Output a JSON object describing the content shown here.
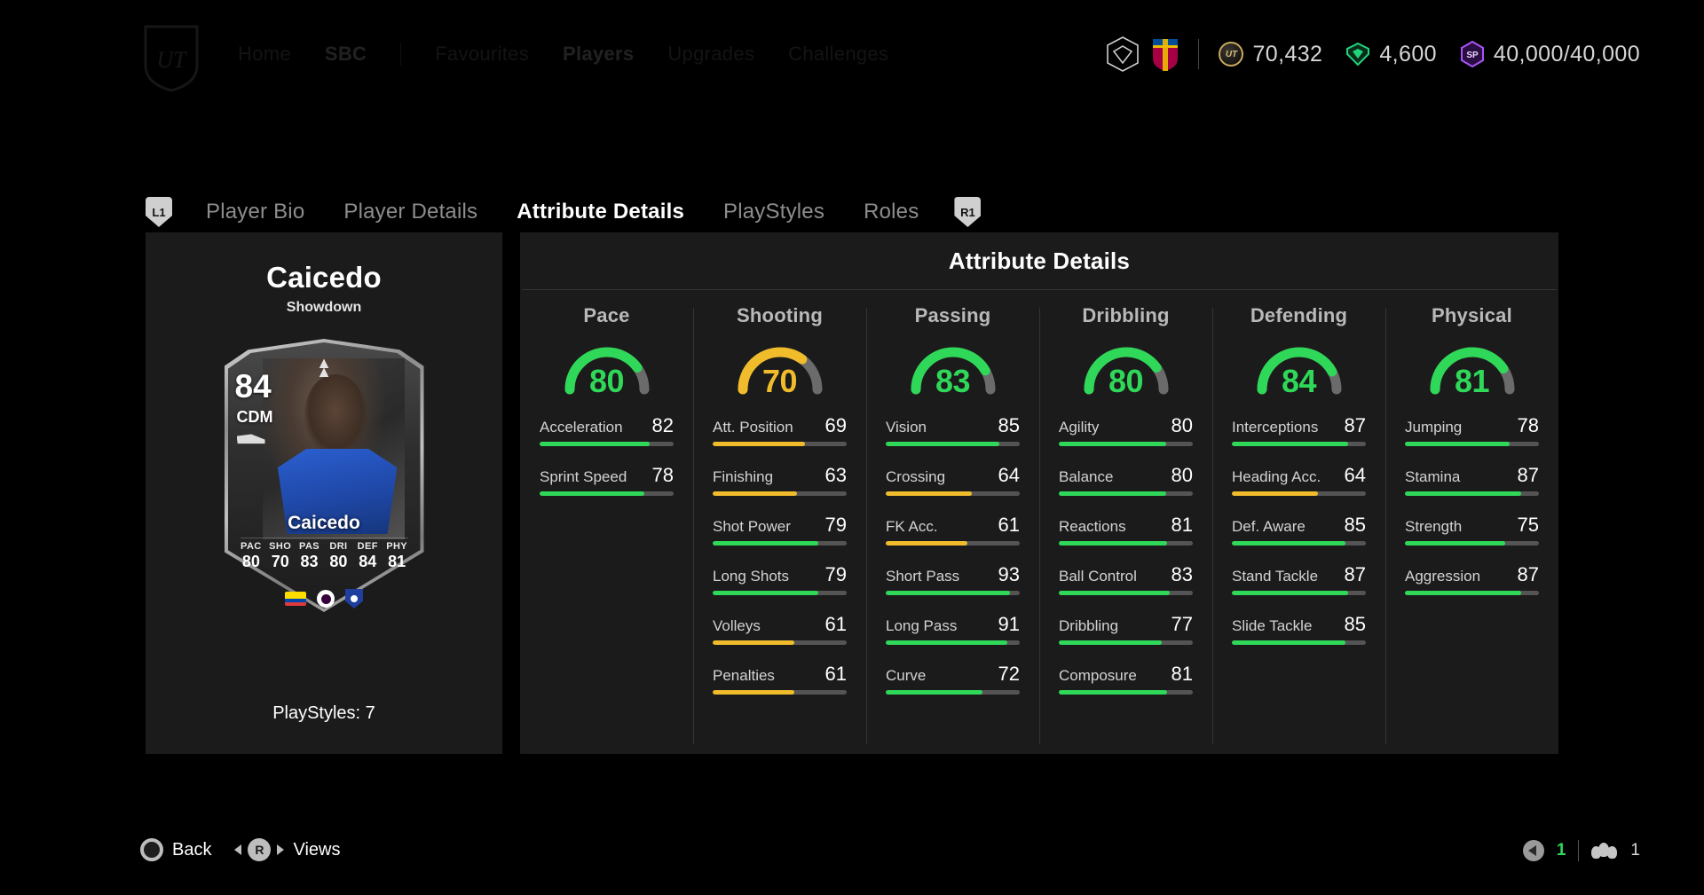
{
  "top_nav": {
    "logo": "ut-shield-logo",
    "items": [
      {
        "label": "Home",
        "emphasis": false
      },
      {
        "label": "SBC",
        "emphasis": true
      },
      {
        "label": "Favourites",
        "emphasis": false
      },
      {
        "label": "Players",
        "emphasis": true
      },
      {
        "label": "Upgrades",
        "emphasis": false
      },
      {
        "label": "Challenges",
        "emphasis": false
      }
    ]
  },
  "currency": {
    "club_badge_label": "club-crest",
    "team_badge_label": "fc-barcelona-crest",
    "coins": "70,432",
    "points": "4,600",
    "sp": "40,000/40,000",
    "coin_icon_text": "UT",
    "sp_icon_text": "SP"
  },
  "tabs": {
    "left_bumper": "L1",
    "right_bumper": "R1",
    "items": [
      {
        "label": "Player Bio",
        "active": false
      },
      {
        "label": "Player Details",
        "active": false
      },
      {
        "label": "Attribute Details",
        "active": true
      },
      {
        "label": "PlayStyles",
        "active": false
      },
      {
        "label": "Roles",
        "active": false
      }
    ]
  },
  "player": {
    "name": "Caicedo",
    "subtitle": "Showdown",
    "playstyles_label": "PlayStyles: 7",
    "card": {
      "rating": "84",
      "position": "CDM",
      "name": "Caicedo",
      "stats": [
        {
          "label": "PAC",
          "value": "80"
        },
        {
          "label": "SHO",
          "value": "70"
        },
        {
          "label": "PAS",
          "value": "83"
        },
        {
          "label": "DRI",
          "value": "80"
        },
        {
          "label": "DEF",
          "value": "84"
        },
        {
          "label": "PHY",
          "value": "81"
        }
      ],
      "nation": "Ecuador",
      "league": "Premier League",
      "club": "Chelsea"
    }
  },
  "attributes": {
    "header": "Attribute Details",
    "colors": {
      "green": "#2fd858",
      "amber": "#f0bc2c",
      "track": "#545454",
      "arc_track": "#6b6b6b"
    },
    "columns": [
      {
        "title": "Pace",
        "overall": 80,
        "overall_color": "green",
        "rows": [
          {
            "label": "Acceleration",
            "value": 82,
            "color": "green"
          },
          {
            "label": "Sprint Speed",
            "value": 78,
            "color": "green"
          }
        ]
      },
      {
        "title": "Shooting",
        "overall": 70,
        "overall_color": "amber",
        "rows": [
          {
            "label": "Att. Position",
            "value": 69,
            "color": "amber"
          },
          {
            "label": "Finishing",
            "value": 63,
            "color": "amber"
          },
          {
            "label": "Shot Power",
            "value": 79,
            "color": "green"
          },
          {
            "label": "Long Shots",
            "value": 79,
            "color": "green"
          },
          {
            "label": "Volleys",
            "value": 61,
            "color": "amber"
          },
          {
            "label": "Penalties",
            "value": 61,
            "color": "amber"
          }
        ]
      },
      {
        "title": "Passing",
        "overall": 83,
        "overall_color": "green",
        "rows": [
          {
            "label": "Vision",
            "value": 85,
            "color": "green"
          },
          {
            "label": "Crossing",
            "value": 64,
            "color": "amber"
          },
          {
            "label": "FK Acc.",
            "value": 61,
            "color": "amber"
          },
          {
            "label": "Short Pass",
            "value": 93,
            "color": "green"
          },
          {
            "label": "Long Pass",
            "value": 91,
            "color": "green"
          },
          {
            "label": "Curve",
            "value": 72,
            "color": "green"
          }
        ]
      },
      {
        "title": "Dribbling",
        "overall": 80,
        "overall_color": "green",
        "rows": [
          {
            "label": "Agility",
            "value": 80,
            "color": "green"
          },
          {
            "label": "Balance",
            "value": 80,
            "color": "green"
          },
          {
            "label": "Reactions",
            "value": 81,
            "color": "green"
          },
          {
            "label": "Ball Control",
            "value": 83,
            "color": "green"
          },
          {
            "label": "Dribbling",
            "value": 77,
            "color": "green"
          },
          {
            "label": "Composure",
            "value": 81,
            "color": "green"
          }
        ]
      },
      {
        "title": "Defending",
        "overall": 84,
        "overall_color": "green",
        "rows": [
          {
            "label": "Interceptions",
            "value": 87,
            "color": "green"
          },
          {
            "label": "Heading Acc.",
            "value": 64,
            "color": "amber"
          },
          {
            "label": "Def. Aware",
            "value": 85,
            "color": "green"
          },
          {
            "label": "Stand Tackle",
            "value": 87,
            "color": "green"
          },
          {
            "label": "Slide Tackle",
            "value": 85,
            "color": "green"
          }
        ]
      },
      {
        "title": "Physical",
        "overall": 81,
        "overall_color": "green",
        "rows": [
          {
            "label": "Jumping",
            "value": 78,
            "color": "green"
          },
          {
            "label": "Stamina",
            "value": 87,
            "color": "green"
          },
          {
            "label": "Strength",
            "value": 75,
            "color": "green"
          },
          {
            "label": "Aggression",
            "value": 87,
            "color": "green"
          }
        ]
      }
    ]
  },
  "bottom_bar": {
    "back_label": "Back",
    "views_label": "Views",
    "views_button": "R",
    "audio_count": "1",
    "players_count": "1"
  }
}
